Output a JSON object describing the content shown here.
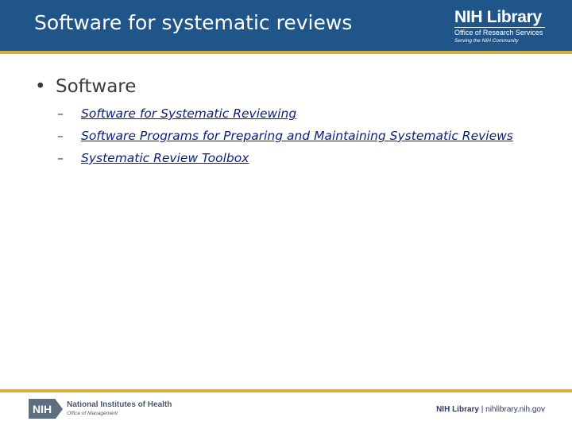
{
  "header": {
    "title": "Software for systematic reviews",
    "logo": {
      "name": "NIH Library",
      "subtitle": "Office of Research Services",
      "tagline": "Serving the NIH Community"
    }
  },
  "content": {
    "bullet": "Software",
    "links": [
      "Software for Systematic Reviewing",
      "Software Programs for Preparing and Maintaining Systematic Reviews",
      "Systematic Review Toolbox"
    ]
  },
  "footer": {
    "left_mark": "NIH",
    "left_name": "National Institutes of Health",
    "left_sub": "Office of Management",
    "right_brand": "NIH Library",
    "right_separator": " | ",
    "right_url": "nihlibrary.nih.gov"
  },
  "colors": {
    "header_bg": "#20558a",
    "accent_gold": "#d6b13e",
    "link": "#0b1f7a"
  }
}
